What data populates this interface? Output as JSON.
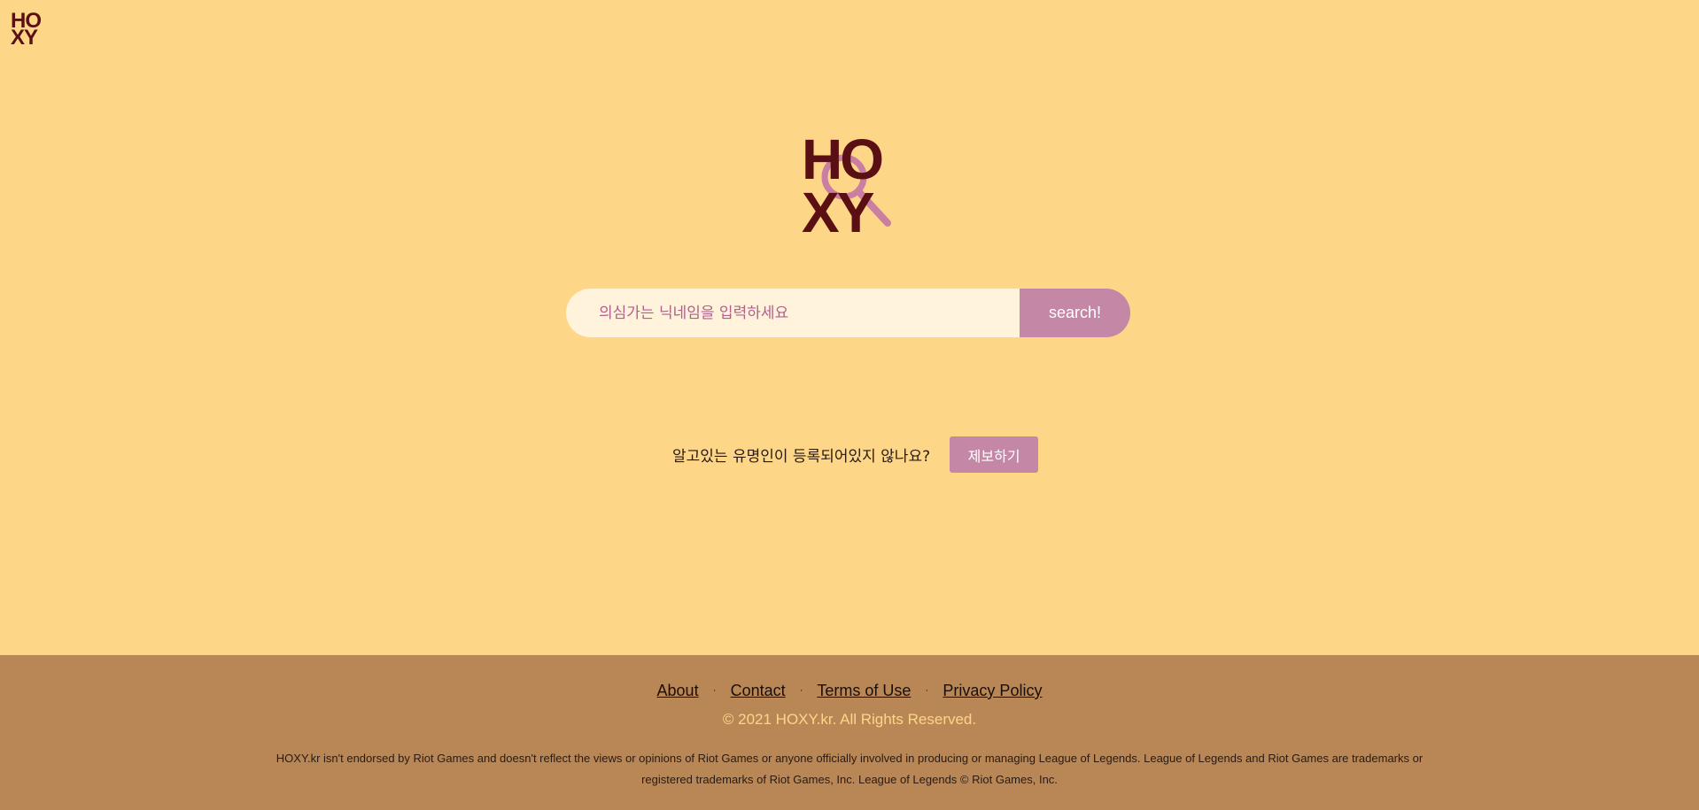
{
  "header": {
    "logo_line1": "HO",
    "logo_line2": "XY"
  },
  "main_logo": {
    "text_line1": "HO",
    "text_line2": "XY",
    "colors": {
      "text": "#5a0f12",
      "magnifier": "#c97ea2"
    }
  },
  "search": {
    "placeholder": "의심가는 닉네임을 입력하세요",
    "value": "",
    "button_label": "search!"
  },
  "report": {
    "prompt": "알고있는 유명인이 등록되어있지 않나요?",
    "button_label": "제보하기"
  },
  "footer": {
    "links": [
      {
        "label": "About"
      },
      {
        "label": "Contact"
      },
      {
        "label": "Terms of Use"
      },
      {
        "label": "Privacy Policy"
      }
    ],
    "separator": "·",
    "copyright": "© 2021 HOXY.kr. All Rights Reserved.",
    "disclaimer": "HOXY.kr isn't endorsed by Riot Games and doesn't reflect the views or opinions of Riot Games or anyone officially involved in producing or managing League of Legends. League of Legends and Riot Games are trademarks or registered trademarks of Riot Games, Inc. League of Legends © Riot Games, Inc."
  },
  "colors": {
    "background": "#fdd688",
    "footer_background": "#b98755",
    "accent": "#c487a6",
    "brand_dark": "#5a0f12",
    "copyright_text": "#fdd688"
  }
}
